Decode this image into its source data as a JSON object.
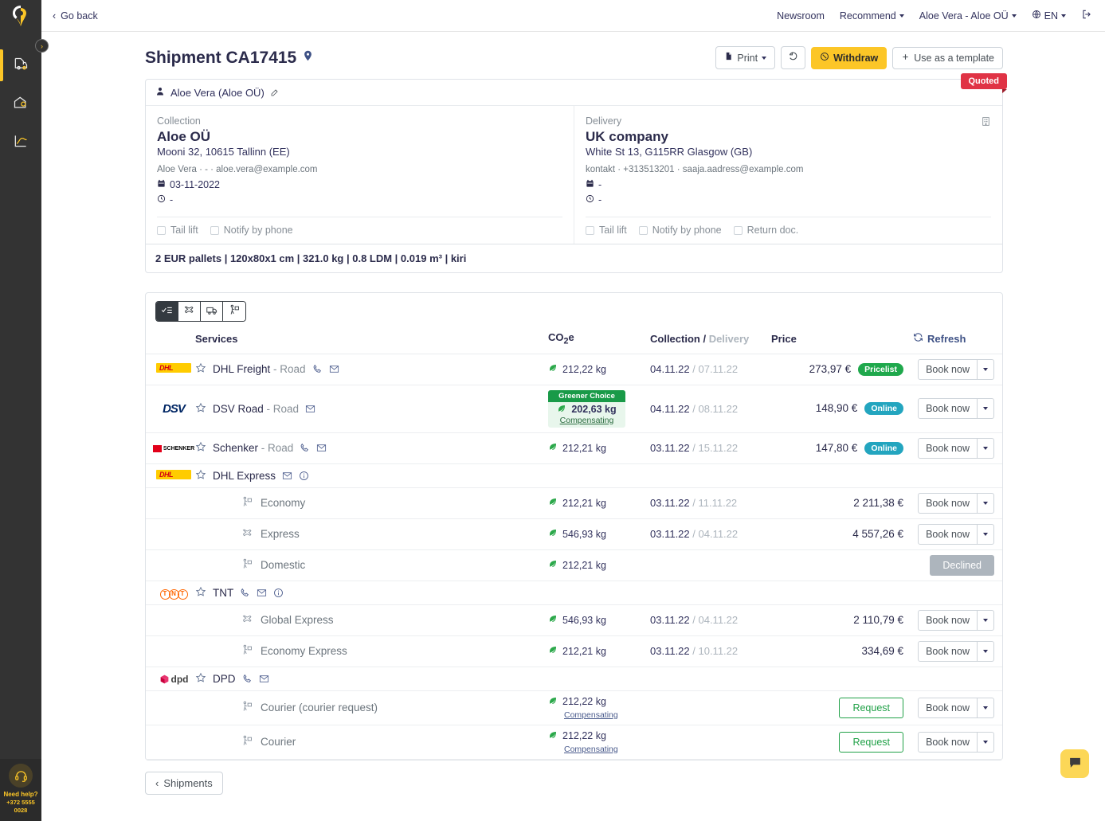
{
  "rail": {
    "logo_icon": "pin-logo-icon",
    "items": [
      {
        "icon": "shipments-truck-doc-icon",
        "name": "sidebar-item-shipments",
        "active": true
      },
      {
        "icon": "warehouse-home-icon",
        "name": "sidebar-item-warehouse",
        "active": false
      },
      {
        "icon": "analytics-chart-icon",
        "name": "sidebar-item-analytics",
        "active": false
      }
    ],
    "toggle_icon": "chevron-right-icon",
    "help": {
      "icon": "headset-icon",
      "title": "Need help?",
      "phone": "+372 5555 0028"
    }
  },
  "topbar": {
    "go_back": "Go back",
    "back_icon": "chevron-left-icon",
    "nav": [
      {
        "label": "Newsroom",
        "caret": false,
        "name": "nav-newsroom"
      },
      {
        "label": "Recommend",
        "caret": true,
        "name": "nav-recommend"
      },
      {
        "label": "Aloe Vera - Aloe OÜ",
        "caret": true,
        "name": "nav-account"
      }
    ],
    "language": {
      "label": "EN",
      "icon": "globe-icon"
    },
    "logout_icon": "logout-icon"
  },
  "header": {
    "title": "Shipment CA17415",
    "title_icon": "map-pin-icon",
    "actions": {
      "print": {
        "label": "Print",
        "icon": "file-icon"
      },
      "history": {
        "label": "",
        "icon": "history-undo-icon"
      },
      "withdraw": {
        "label": "Withdraw",
        "icon": "cancel-circle-icon"
      },
      "template": {
        "label": "Use as a template",
        "icon": "plus-icon"
      }
    }
  },
  "shipment": {
    "owner": "Aloe Vera (Aloe OÜ)",
    "owner_icon": "user-icon",
    "edit_icon": "edit-pencil-icon",
    "status_badge": "Quoted",
    "collection": {
      "label": "Collection",
      "company": "Aloe OÜ",
      "address": "Mooni 32, 10615 Tallinn (EE)",
      "contact": "Aloe Vera  ·  -  ·  aloe.vera@example.com",
      "date": "03-11-2022",
      "time": "-",
      "date_icon": "calendar-icon",
      "time_icon": "clock-icon",
      "options": [
        {
          "label": "Tail lift",
          "checked": false
        },
        {
          "label": "Notify by phone",
          "checked": false
        }
      ]
    },
    "delivery": {
      "label": "Delivery",
      "company": "UK company",
      "address": "White St 13, G115RR Glasgow (GB)",
      "contact": "kontakt  ·  +313513201  ·  saaja.aadress@example.com",
      "date": "-",
      "time": "-",
      "date_icon": "calendar-icon",
      "time_icon": "clock-icon",
      "building_icon": "building-icon",
      "options": [
        {
          "label": "Tail lift",
          "checked": false
        },
        {
          "label": "Notify by phone",
          "checked": false
        },
        {
          "label": "Return doc.",
          "checked": false
        }
      ]
    },
    "cargo_summary": "2 EUR pallets  |  120x80x1 cm  |  321.0 kg  |  0.8 LDM  |  0.019 m³  |  kiri"
  },
  "offers": {
    "mode_tabs": [
      {
        "icon": "all-services-checklist-icon",
        "name": "tab-all",
        "active": true
      },
      {
        "icon": "airplane-icon",
        "name": "tab-air",
        "active": false
      },
      {
        "icon": "truck-icon",
        "name": "tab-road",
        "active": false
      },
      {
        "icon": "courier-icon",
        "name": "tab-courier",
        "active": false
      }
    ],
    "columns": {
      "services": "Services",
      "co2": "CO₂e",
      "collection": "Collection",
      "separator": " / ",
      "delivery": "Delivery",
      "price": "Price",
      "refresh": "Refresh",
      "refresh_icon": "refresh-icon"
    },
    "rows": [
      {
        "kind": "carrier",
        "logo": "dhl",
        "star": true,
        "name": "DHL Freight",
        "mode": " - Road",
        "icons": [
          "phone-icon",
          "mail-icon"
        ],
        "co2": "212,22 kg",
        "co2_highlight": false,
        "collection_date": "04.11.22",
        "delivery_date": "07.11.22",
        "price": "273,97 €",
        "badge": {
          "label": "Pricelist",
          "color": "green"
        },
        "action": "book"
      },
      {
        "kind": "carrier",
        "logo": "dsv",
        "star": true,
        "name": "DSV Road",
        "mode": " - Road",
        "icons": [
          "mail-icon"
        ],
        "co2": "202,63 kg",
        "co2_highlight": true,
        "co2_badge": "Greener Choice",
        "co2_link": "Compensating",
        "collection_date": "04.11.22",
        "delivery_date": "08.11.22",
        "price": "148,90 €",
        "badge": {
          "label": "Online",
          "color": "teal"
        },
        "action": "book"
      },
      {
        "kind": "carrier",
        "logo": "schenker",
        "star": true,
        "name": "Schenker",
        "mode": " - Road",
        "icons": [
          "phone-icon",
          "mail-icon"
        ],
        "co2": "212,21 kg",
        "co2_highlight": false,
        "collection_date": "03.11.22",
        "delivery_date": "15.11.22",
        "price": "147,80 €",
        "badge": {
          "label": "Online",
          "color": "teal"
        },
        "action": "book"
      },
      {
        "kind": "group",
        "logo": "dhl",
        "star": true,
        "name": "DHL Express",
        "mode": "",
        "icons": [
          "mail-icon",
          "info-icon"
        ],
        "action": "none"
      },
      {
        "kind": "sub",
        "icon": "courier-icon",
        "name": "Economy",
        "co2": "212,21 kg",
        "collection_date": "03.11.22",
        "delivery_date": "11.11.22",
        "price": "2 211,38 €",
        "action": "book"
      },
      {
        "kind": "sub",
        "icon": "airplane-icon",
        "name": "Express",
        "co2": "546,93 kg",
        "collection_date": "03.11.22",
        "delivery_date": "04.11.22",
        "price": "4 557,26 €",
        "action": "book"
      },
      {
        "kind": "sub",
        "icon": "courier-icon",
        "name": "Domestic",
        "co2": "212,21 kg",
        "collection_date": "",
        "delivery_date": "",
        "price": "",
        "action": "declined",
        "declined_label": "Declined"
      },
      {
        "kind": "group",
        "logo": "tnt",
        "star": true,
        "name": "TNT",
        "mode": "",
        "icons": [
          "phone-icon",
          "mail-icon",
          "info-icon"
        ],
        "action": "none"
      },
      {
        "kind": "sub",
        "icon": "airplane-icon",
        "name": "Global Express",
        "co2": "546,93 kg",
        "collection_date": "03.11.22",
        "delivery_date": "04.11.22",
        "price": "2 110,79 €",
        "action": "book"
      },
      {
        "kind": "sub",
        "icon": "courier-icon",
        "name": "Economy Express",
        "co2": "212,21 kg",
        "collection_date": "03.11.22",
        "delivery_date": "10.11.22",
        "price": "334,69 €",
        "action": "book"
      },
      {
        "kind": "group",
        "logo": "dpd",
        "star": true,
        "name": "DPD",
        "mode": "",
        "icons": [
          "phone-icon",
          "mail-icon"
        ],
        "action": "none"
      },
      {
        "kind": "sub",
        "icon": "courier-icon",
        "name": "Courier (courier request)",
        "co2": "212,22 kg",
        "co2_link": "Compensating",
        "collection_date": "",
        "delivery_date": "",
        "price": "",
        "action": "request",
        "request_label": "Request"
      },
      {
        "kind": "sub",
        "icon": "courier-icon",
        "name": "Courier",
        "co2": "212,22 kg",
        "co2_link": "Compensating",
        "collection_date": "",
        "delivery_date": "",
        "price": "",
        "action": "request",
        "request_label": "Request"
      }
    ],
    "book_label": "Book now"
  },
  "footer": {
    "shipments_label": "Shipments",
    "back_icon": "chevron-left-icon"
  },
  "chat": {
    "icon": "chat-bubble-icon"
  },
  "colors": {
    "brand_yellow": "#fcc627",
    "rail_dark": "#333333",
    "status_red": "#e03345",
    "green": "#1fa84c",
    "teal": "#23a5bf"
  }
}
